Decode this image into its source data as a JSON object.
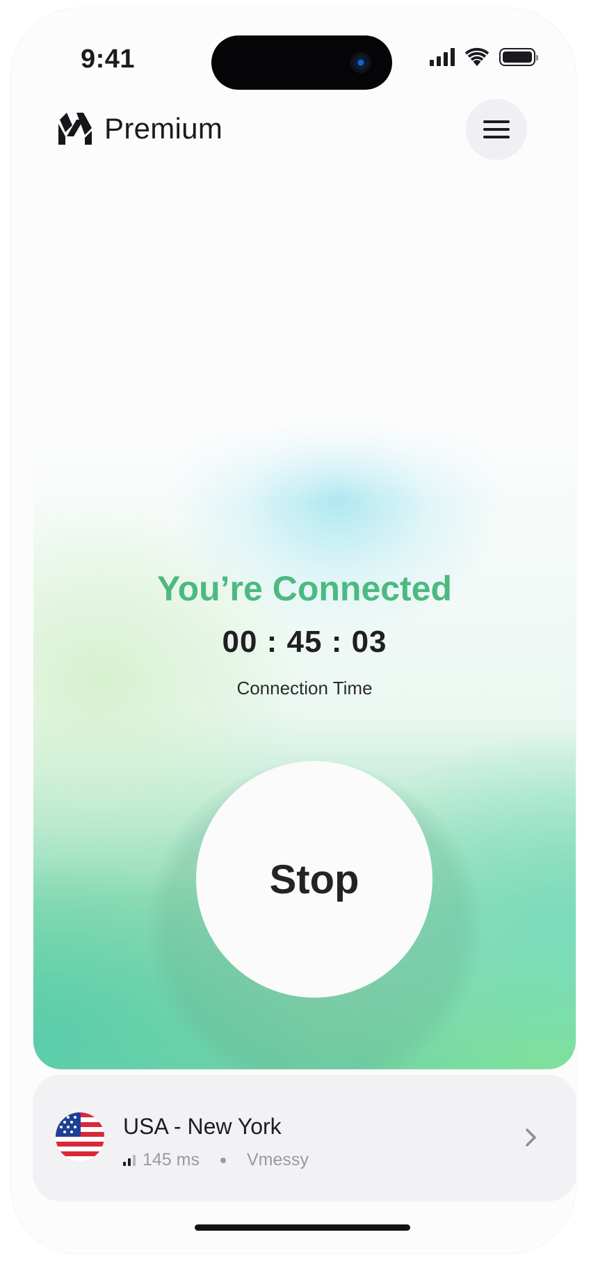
{
  "status_bar": {
    "time": "9:41",
    "signal_icon": "cellular-signal-icon",
    "wifi_icon": "wifi-icon",
    "battery_icon": "battery-icon"
  },
  "header": {
    "brand_name": "Premium",
    "logo_icon": "brand-logo-icon",
    "menu_icon": "hamburger-menu-icon"
  },
  "connection": {
    "status": "You’re Connected",
    "timer": "00 : 45 : 03",
    "timer_label": "Connection Time",
    "button_label": "Stop",
    "status_color": "#4cb981"
  },
  "server": {
    "flag_icon": "usa-flag-icon",
    "name": "USA - New York",
    "ping": "145 ms",
    "protocol": "Vmessy",
    "chevron_icon": "chevron-right-icon"
  }
}
